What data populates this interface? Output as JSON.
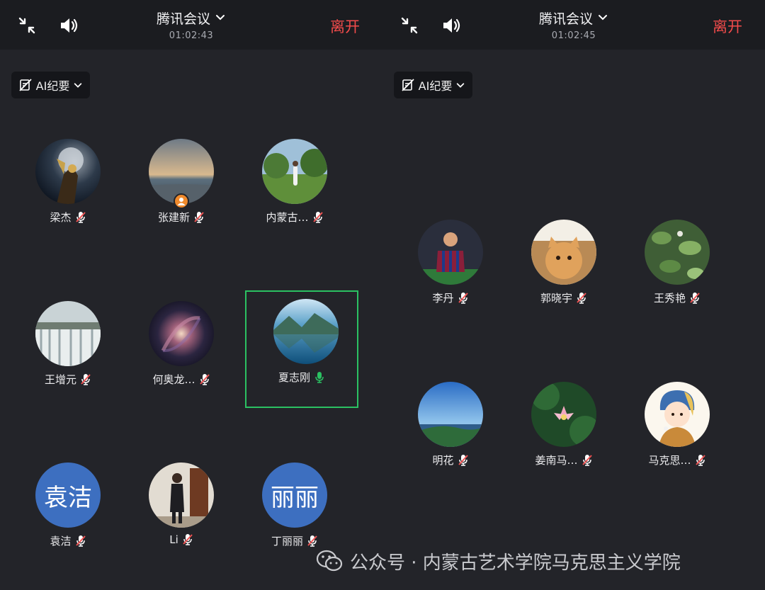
{
  "left": {
    "title": "腾讯会议",
    "timer": "01:02:43",
    "leave": "离开",
    "ai_label": "AI纪要",
    "participants": [
      {
        "name": "梁杰"
      },
      {
        "name": "张建新"
      },
      {
        "name": "内蒙古…"
      },
      {
        "name": "王增元"
      },
      {
        "name": "何奥龙…"
      },
      {
        "name": "夏志刚"
      },
      {
        "name": "袁洁",
        "avatar_text": "袁洁"
      },
      {
        "name": "Li"
      },
      {
        "name": "丁丽丽",
        "avatar_text": "丽丽"
      }
    ]
  },
  "right": {
    "title": "腾讯会议",
    "timer": "01:02:45",
    "leave": "离开",
    "ai_label": "AI纪要",
    "participants": [
      {
        "name": "李丹"
      },
      {
        "name": "郭晓宇"
      },
      {
        "name": "王秀艳"
      },
      {
        "name": "明花"
      },
      {
        "name": "姜南马…"
      },
      {
        "name": "马克思…"
      }
    ]
  },
  "watermark": "公众号 · 内蒙古艺术学院马克思主义学院",
  "colors": {
    "background": "#232429",
    "topbar": "#1b1c20",
    "leave": "#f24b4b",
    "speaking_border": "#2bc162",
    "muted_mic": "#f05454",
    "text_avatar": "#3d6fc0"
  },
  "icons": [
    "shrink-icon",
    "speaker-icon",
    "chevron-down-icon",
    "ai-notes-off-icon",
    "mic-muted-icon",
    "mic-active-icon",
    "host-badge-icon",
    "wechat-icon"
  ]
}
